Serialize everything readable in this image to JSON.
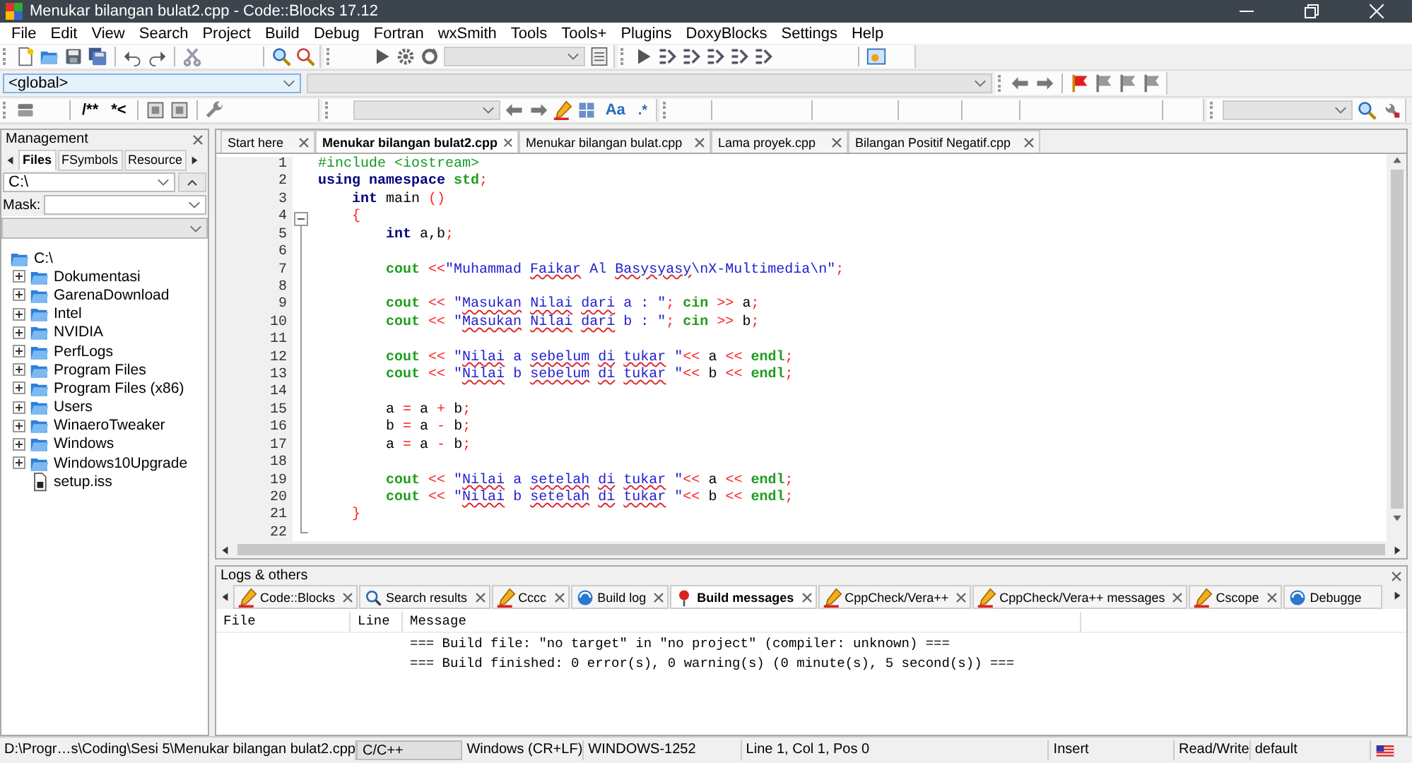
{
  "window": {
    "title": "Menukar bilangan bulat2.cpp - Code::Blocks 17.12"
  },
  "menu": [
    "File",
    "Edit",
    "View",
    "Search",
    "Project",
    "Build",
    "Debug",
    "Fortran",
    "wxSmith",
    "Tools",
    "Tools+",
    "Plugins",
    "DoxyBlocks",
    "Settings",
    "Help"
  ],
  "toolbar": {
    "scope_combo": "<global>",
    "doc_buttons": [
      "/**",
      "*<"
    ],
    "search_options": [
      "Aa",
      ".*"
    ]
  },
  "management": {
    "title": "Management",
    "tabs": [
      {
        "label": "Files",
        "selected": true
      },
      {
        "label": "FSymbols",
        "selected": false
      },
      {
        "label": "Resource",
        "selected": false
      }
    ],
    "path_combo": "C:\\",
    "mask_label": "Mask:",
    "tree": {
      "label": "C:\\",
      "kind": "folder",
      "expanded": true,
      "children": [
        {
          "label": "Dokumentasi",
          "kind": "folder",
          "expanded": false
        },
        {
          "label": "GarenaDownload",
          "kind": "folder",
          "expanded": false
        },
        {
          "label": "Intel",
          "kind": "folder",
          "expanded": false
        },
        {
          "label": "NVIDIA",
          "kind": "folder",
          "expanded": false
        },
        {
          "label": "PerfLogs",
          "kind": "folder",
          "expanded": false
        },
        {
          "label": "Program Files",
          "kind": "folder",
          "expanded": false
        },
        {
          "label": "Program Files (x86)",
          "kind": "folder",
          "expanded": false
        },
        {
          "label": "Users",
          "kind": "folder",
          "expanded": false
        },
        {
          "label": "WinaeroTweaker",
          "kind": "folder",
          "expanded": false
        },
        {
          "label": "Windows",
          "kind": "folder",
          "expanded": false
        },
        {
          "label": "Windows10Upgrade",
          "kind": "folder",
          "expanded": false
        },
        {
          "label": "setup.iss",
          "kind": "file"
        }
      ]
    }
  },
  "editor": {
    "tabs": [
      {
        "label": "Start here",
        "selected": false
      },
      {
        "label": "Menukar bilangan bulat2.cpp",
        "selected": true
      },
      {
        "label": "Menukar bilangan bulat.cpp",
        "selected": false
      },
      {
        "label": "Lama proyek.cpp",
        "selected": false
      },
      {
        "label": "Bilangan Positif Negatif.cpp",
        "selected": false
      }
    ],
    "lines": [
      {
        "number": "1",
        "tokens": [
          {
            "text": "#include <iostream>",
            "kind": "pre"
          }
        ]
      },
      {
        "number": "2",
        "tokens": [
          {
            "text": "using namespace ",
            "kind": "kw"
          },
          {
            "text": "std",
            "kind": "id"
          },
          {
            "text": ";",
            "kind": "op"
          }
        ]
      },
      {
        "number": "3",
        "tokens": [
          {
            "text": "    int",
            "kind": "kw"
          },
          {
            "text": " main ",
            "kind": "plain"
          },
          {
            "text": "()",
            "kind": "op"
          }
        ]
      },
      {
        "number": "4",
        "tokens": [
          {
            "text": "    {",
            "kind": "op"
          }
        ]
      },
      {
        "number": "5",
        "tokens": [
          {
            "text": "        int",
            "kind": "kw"
          },
          {
            "text": " a,b",
            "kind": "plain"
          },
          {
            "text": ";",
            "kind": "op"
          }
        ]
      },
      {
        "number": "6"
      },
      {
        "number": "7",
        "tokens": [
          {
            "text": "        cout",
            "kind": "id"
          },
          {
            "text": " <<",
            "kind": "op"
          },
          {
            "text": "\"Muhammad ",
            "kind": "str"
          },
          {
            "text": "Faikar",
            "kind": "err"
          },
          {
            "text": " Al ",
            "kind": "str"
          },
          {
            "text": "Basysyasy",
            "kind": "err"
          },
          {
            "text": "\\nX-Multimedia\\n\"",
            "kind": "str"
          },
          {
            "text": ";",
            "kind": "op"
          }
        ]
      },
      {
        "number": "8"
      },
      {
        "number": "9",
        "tokens": [
          {
            "text": "        cout",
            "kind": "id"
          },
          {
            "text": " << ",
            "kind": "op"
          },
          {
            "text": "\"",
            "kind": "str"
          },
          {
            "text": "Masukan ",
            "kind": "err"
          },
          {
            "text": "Nilai ",
            "kind": "err"
          },
          {
            "text": "dari",
            "kind": "err"
          },
          {
            "text": " a : \"",
            "kind": "str"
          },
          {
            "text": "; ",
            "kind": "op"
          },
          {
            "text": "cin",
            "kind": "id"
          },
          {
            "text": " >> ",
            "kind": "op"
          },
          {
            "text": "a",
            "kind": "plain"
          },
          {
            "text": ";",
            "kind": "op"
          }
        ]
      },
      {
        "number": "10",
        "tokens": [
          {
            "text": "        cout",
            "kind": "id"
          },
          {
            "text": " << ",
            "kind": "op"
          },
          {
            "text": "\"",
            "kind": "str"
          },
          {
            "text": "Masukan ",
            "kind": "err"
          },
          {
            "text": "Nilai ",
            "kind": "err"
          },
          {
            "text": "dari",
            "kind": "err"
          },
          {
            "text": " b : \"",
            "kind": "str"
          },
          {
            "text": "; ",
            "kind": "op"
          },
          {
            "text": "cin",
            "kind": "id"
          },
          {
            "text": " >> ",
            "kind": "op"
          },
          {
            "text": "b",
            "kind": "plain"
          },
          {
            "text": ";",
            "kind": "op"
          }
        ]
      },
      {
        "number": "11"
      },
      {
        "number": "12",
        "tokens": [
          {
            "text": "        cout",
            "kind": "id"
          },
          {
            "text": " << ",
            "kind": "op"
          },
          {
            "text": "\"",
            "kind": "str"
          },
          {
            "text": "Nilai",
            "kind": "err"
          },
          {
            "text": " a ",
            "kind": "str"
          },
          {
            "text": "sebelum ",
            "kind": "err"
          },
          {
            "text": "di ",
            "kind": "err"
          },
          {
            "text": "tukar",
            "kind": "err"
          },
          {
            "text": " \"",
            "kind": "str"
          },
          {
            "text": "<<",
            "kind": "op"
          },
          {
            "text": " a ",
            "kind": "plain"
          },
          {
            "text": "<< ",
            "kind": "op"
          },
          {
            "text": "endl",
            "kind": "id"
          },
          {
            "text": ";",
            "kind": "op"
          }
        ]
      },
      {
        "number": "13",
        "tokens": [
          {
            "text": "        cout",
            "kind": "id"
          },
          {
            "text": " << ",
            "kind": "op"
          },
          {
            "text": "\"",
            "kind": "str"
          },
          {
            "text": "Nilai",
            "kind": "err"
          },
          {
            "text": " b ",
            "kind": "str"
          },
          {
            "text": "sebelum ",
            "kind": "err"
          },
          {
            "text": "di ",
            "kind": "err"
          },
          {
            "text": "tukar",
            "kind": "err"
          },
          {
            "text": " \"",
            "kind": "str"
          },
          {
            "text": "<<",
            "kind": "op"
          },
          {
            "text": " b ",
            "kind": "plain"
          },
          {
            "text": "<< ",
            "kind": "op"
          },
          {
            "text": "endl",
            "kind": "id"
          },
          {
            "text": ";",
            "kind": "op"
          }
        ]
      },
      {
        "number": "14"
      },
      {
        "number": "15",
        "tokens": [
          {
            "text": "        a ",
            "kind": "plain"
          },
          {
            "text": "=",
            "kind": "op"
          },
          {
            "text": " a ",
            "kind": "plain"
          },
          {
            "text": "+",
            "kind": "op"
          },
          {
            "text": " b",
            "kind": "plain"
          },
          {
            "text": ";",
            "kind": "op"
          }
        ]
      },
      {
        "number": "16",
        "tokens": [
          {
            "text": "        b ",
            "kind": "plain"
          },
          {
            "text": "=",
            "kind": "op"
          },
          {
            "text": " a ",
            "kind": "plain"
          },
          {
            "text": "-",
            "kind": "op"
          },
          {
            "text": " b",
            "kind": "plain"
          },
          {
            "text": ";",
            "kind": "op"
          }
        ]
      },
      {
        "number": "17",
        "tokens": [
          {
            "text": "        a ",
            "kind": "plain"
          },
          {
            "text": "=",
            "kind": "op"
          },
          {
            "text": " a ",
            "kind": "plain"
          },
          {
            "text": "-",
            "kind": "op"
          },
          {
            "text": " b",
            "kind": "plain"
          },
          {
            "text": ";",
            "kind": "op"
          }
        ]
      },
      {
        "number": "18"
      },
      {
        "number": "19",
        "tokens": [
          {
            "text": "        cout",
            "kind": "id"
          },
          {
            "text": " << ",
            "kind": "op"
          },
          {
            "text": "\"",
            "kind": "str"
          },
          {
            "text": "Nilai",
            "kind": "err"
          },
          {
            "text": " a ",
            "kind": "str"
          },
          {
            "text": "setelah ",
            "kind": "err"
          },
          {
            "text": "di ",
            "kind": "err"
          },
          {
            "text": "tukar",
            "kind": "err"
          },
          {
            "text": " \"",
            "kind": "str"
          },
          {
            "text": "<<",
            "kind": "op"
          },
          {
            "text": " a ",
            "kind": "plain"
          },
          {
            "text": "<< ",
            "kind": "op"
          },
          {
            "text": "endl",
            "kind": "id"
          },
          {
            "text": ";",
            "kind": "op"
          }
        ]
      },
      {
        "number": "20",
        "tokens": [
          {
            "text": "        cout",
            "kind": "id"
          },
          {
            "text": " << ",
            "kind": "op"
          },
          {
            "text": "\"",
            "kind": "str"
          },
          {
            "text": "Nilai",
            "kind": "err"
          },
          {
            "text": " b ",
            "kind": "str"
          },
          {
            "text": "setelah ",
            "kind": "err"
          },
          {
            "text": "di ",
            "kind": "err"
          },
          {
            "text": "tukar",
            "kind": "err"
          },
          {
            "text": " \"",
            "kind": "str"
          },
          {
            "text": "<<",
            "kind": "op"
          },
          {
            "text": " b ",
            "kind": "plain"
          },
          {
            "text": "<< ",
            "kind": "op"
          },
          {
            "text": "endl",
            "kind": "id"
          },
          {
            "text": ";",
            "kind": "op"
          }
        ]
      },
      {
        "number": "21",
        "tokens": [
          {
            "text": "    }",
            "kind": "op"
          }
        ]
      },
      {
        "number": "22"
      }
    ]
  },
  "logs": {
    "title": "Logs & others",
    "tabs": [
      {
        "label": "Code::Blocks",
        "selected": false
      },
      {
        "label": "Search results",
        "selected": false
      },
      {
        "label": "Cccc",
        "selected": false
      },
      {
        "label": "Build log",
        "selected": false
      },
      {
        "label": "Build messages",
        "selected": true
      },
      {
        "label": "CppCheck/Vera++",
        "selected": false
      },
      {
        "label": "CppCheck/Vera++ messages",
        "selected": false
      },
      {
        "label": "Cscope",
        "selected": false
      },
      {
        "label": "Debugge",
        "selected": false
      }
    ],
    "columns": [
      "File",
      "Line",
      "Message"
    ],
    "rows": [
      {
        "message": "=== Build file: \"no target\" in \"no project\" (compiler: unknown) ==="
      },
      {
        "message": "=== Build finished: 0 error(s), 0 warning(s) (0 minute(s), 5 second(s)) ==="
      }
    ]
  },
  "status_bar": [
    "D:\\Progr…s\\Coding\\Sesi 5\\Menukar bilangan bulat2.cpp",
    "C/C++",
    "Windows (CR+LF)",
    "WINDOWS-1252",
    "Line 1, Col 1, Pos 0",
    "Insert",
    "Read/Write",
    "default"
  ]
}
